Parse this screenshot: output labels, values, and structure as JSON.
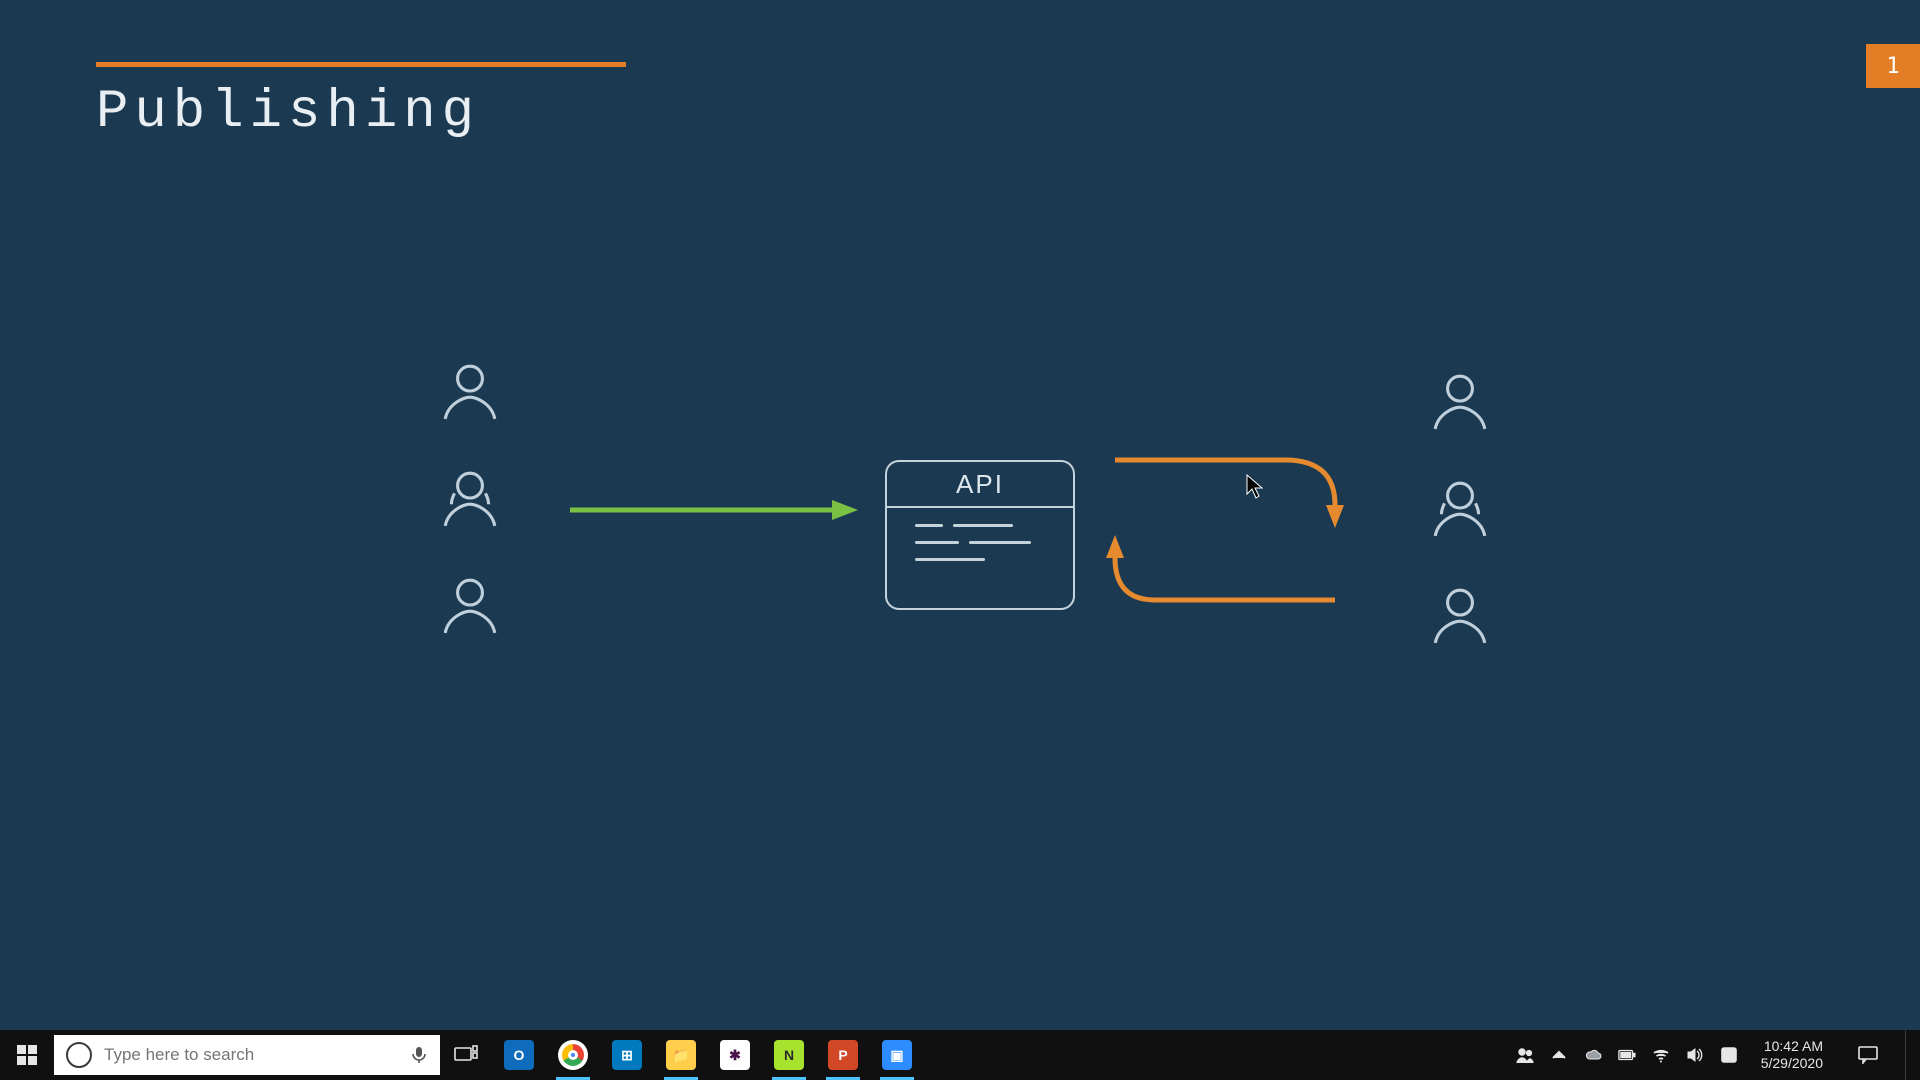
{
  "slide": {
    "title": "Publishing",
    "number": "1",
    "api_label": "API"
  },
  "taskbar": {
    "search_placeholder": "Type here to search",
    "apps": {
      "outlook": "O",
      "chrome": "",
      "trello": "⊞",
      "explorer": "📁",
      "slack": "✱",
      "npp": "N",
      "ppt": "P",
      "zoom": "▣"
    },
    "clock_time": "10:42 AM",
    "clock_date": "5/29/2020"
  }
}
